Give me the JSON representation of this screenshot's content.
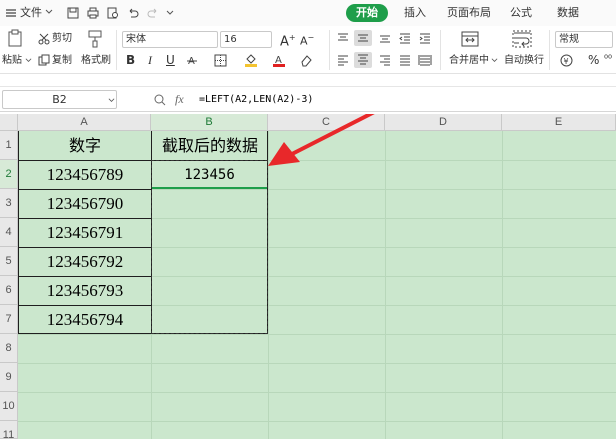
{
  "menubar": {
    "file_label": "文件",
    "tabs": [
      "开始",
      "插入",
      "页面布局",
      "公式",
      "数据"
    ]
  },
  "ribbon": {
    "paste_label": "粘贴",
    "cut_label": "剪切",
    "copy_label": "复制",
    "format_painter_label": "格式刷",
    "font_name": "宋体",
    "font_size": "16",
    "merge_center_label": "合并居中",
    "wrap_text_label": "自动换行",
    "number_format": "常规"
  },
  "formula_bar": {
    "cell_ref": "B2",
    "fx_label": "fx",
    "formula": "=LEFT(A2,LEN(A2)-3)"
  },
  "sheet": {
    "columns": [
      "A",
      "B",
      "C",
      "D",
      "E"
    ],
    "selected_column": "B",
    "rows": [
      "1",
      "2",
      "3",
      "4",
      "5",
      "6",
      "7",
      "8",
      "9",
      "10",
      "11"
    ],
    "selected_row": "2",
    "cells": {
      "A1": "数字",
      "B1": "截取后的数据",
      "A2": "123456789",
      "A3": "123456790",
      "A4": "123456791",
      "A5": "123456792",
      "A6": "123456793",
      "A7": "123456794",
      "B2": "123456"
    }
  },
  "colors": {
    "accent": "#1e9e4a",
    "grid_background": "#cbe7cd",
    "arrow": "#e8282a"
  }
}
